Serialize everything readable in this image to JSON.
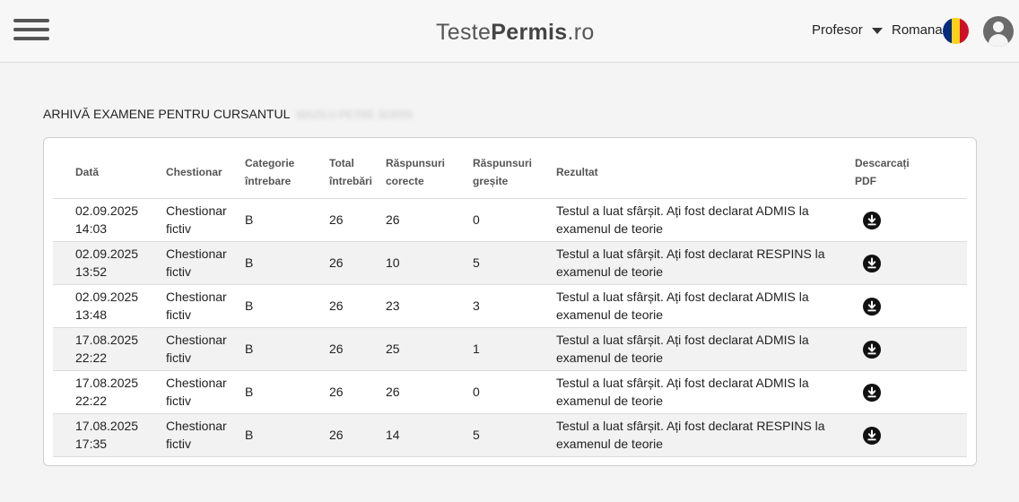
{
  "header": {
    "menu_icon": "hamburger-icon",
    "logo_light": "Teste",
    "logo_bold": "Permis",
    "logo_suffix": ".ro",
    "role_label": "Profesor",
    "language_label": "Romana",
    "flag_colors": [
      "#002B7F",
      "#FCD116",
      "#CE1126"
    ],
    "avatar_icon": "user-avatar-icon"
  },
  "page": {
    "title": "ARHIVĂ EXAMENE PENTRU CURSANTUL",
    "student_name": "MAZILU PETRE SORIN"
  },
  "table": {
    "headers": {
      "date": "Dată",
      "questionnaire": "Chestionar",
      "category_line1": "Categorie",
      "category_line2": "întrebare",
      "total_line1": "Total",
      "total_line2": "întrebări",
      "correct_line1": "Răspunsuri",
      "correct_line2": "corecte",
      "wrong_line1": "Răspunsuri",
      "wrong_line2": "greșite",
      "result": "Rezultat",
      "pdf_line1": "Descarcați",
      "pdf_line2": "PDF"
    },
    "rows": [
      {
        "date": "02.09.2025",
        "time": "14:03",
        "q1": "Chestionar",
        "q2": "fictiv",
        "category": "B",
        "total": "26",
        "correct": "26",
        "wrong": "0",
        "result1": "Testul a luat sfârșit. Ați fost declarat ADMIS la",
        "result2": "examenul de teorie"
      },
      {
        "date": "02.09.2025",
        "time": "13:52",
        "q1": "Chestionar",
        "q2": "fictiv",
        "category": "B",
        "total": "26",
        "correct": "10",
        "wrong": "5",
        "result1": "Testul a luat sfârșit. Ați fost declarat RESPINS la",
        "result2": "examenul de teorie"
      },
      {
        "date": "02.09.2025",
        "time": "13:48",
        "q1": "Chestionar",
        "q2": "fictiv",
        "category": "B",
        "total": "26",
        "correct": "23",
        "wrong": "3",
        "result1": "Testul a luat sfârșit. Ați fost declarat ADMIS la",
        "result2": "examenul de teorie"
      },
      {
        "date": "17.08.2025",
        "time": "22:22",
        "q1": "Chestionar",
        "q2": "fictiv",
        "category": "B",
        "total": "26",
        "correct": "25",
        "wrong": "1",
        "result1": "Testul a luat sfârșit. Ați fost declarat ADMIS la",
        "result2": "examenul de teorie"
      },
      {
        "date": "17.08.2025",
        "time": "22:22",
        "q1": "Chestionar",
        "q2": "fictiv",
        "category": "B",
        "total": "26",
        "correct": "26",
        "wrong": "0",
        "result1": "Testul a luat sfârșit. Ați fost declarat ADMIS la",
        "result2": "examenul de teorie"
      },
      {
        "date": "17.08.2025",
        "time": "17:35",
        "q1": "Chestionar",
        "q2": "fictiv",
        "category": "B",
        "total": "26",
        "correct": "14",
        "wrong": "5",
        "result1": "Testul a luat sfârșit. Ați fost declarat RESPINS la",
        "result2": "examenul de teorie"
      }
    ],
    "download_icon": "download-circle-icon"
  }
}
